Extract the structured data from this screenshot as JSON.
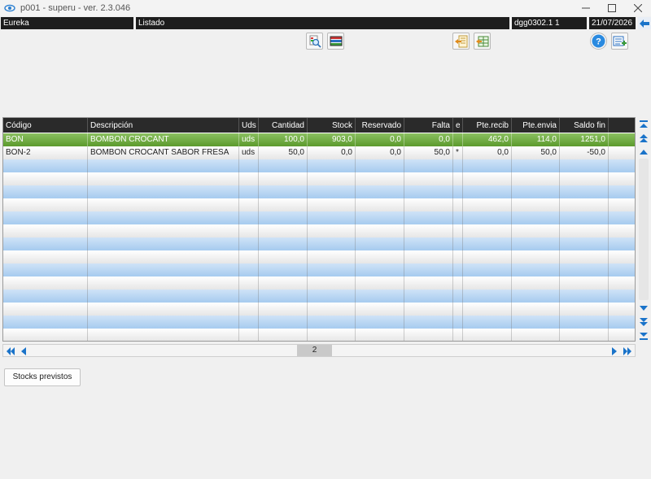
{
  "window": {
    "title": "p001 - superu - ver. 2.3.046"
  },
  "statusbar": {
    "company": "Eureka",
    "screen": "Listado",
    "station": "dgg0302.1  1",
    "date": "21/07/2026"
  },
  "grid": {
    "columns": [
      "Código",
      "Descripción",
      "Uds",
      "Cantidad",
      "Stock",
      "Reservado",
      "Falta",
      "e",
      "Pte.recib",
      "Pte.envia",
      "Saldo fin"
    ],
    "rows": [
      [
        "BON",
        "BOMBON CROCANT",
        "uds",
        "100,0",
        "903,0",
        "0,0",
        "0,0",
        "",
        "462,0",
        "114,0",
        "1251,0"
      ],
      [
        "BON-2",
        "BOMBON CROCANT SABOR FRESA",
        "uds",
        "50,0",
        "0,0",
        "0,0",
        "50,0",
        "*",
        "0,0",
        "50,0",
        "-50,0"
      ]
    ],
    "selected_row": 0
  },
  "pager": {
    "page": "2"
  },
  "actions": {
    "stocks_previstos": "Stocks previstos"
  },
  "colors": {
    "selected_row": "#6aa83a",
    "stripe": "#b8d6f3",
    "header": "#2a2a2a",
    "accent": "#1a73c9"
  },
  "icons": {
    "toolbar": [
      "search-icon",
      "grid-colors-icon",
      "import-icon",
      "export-grid-icon",
      "help-icon",
      "edit-list-icon"
    ]
  }
}
